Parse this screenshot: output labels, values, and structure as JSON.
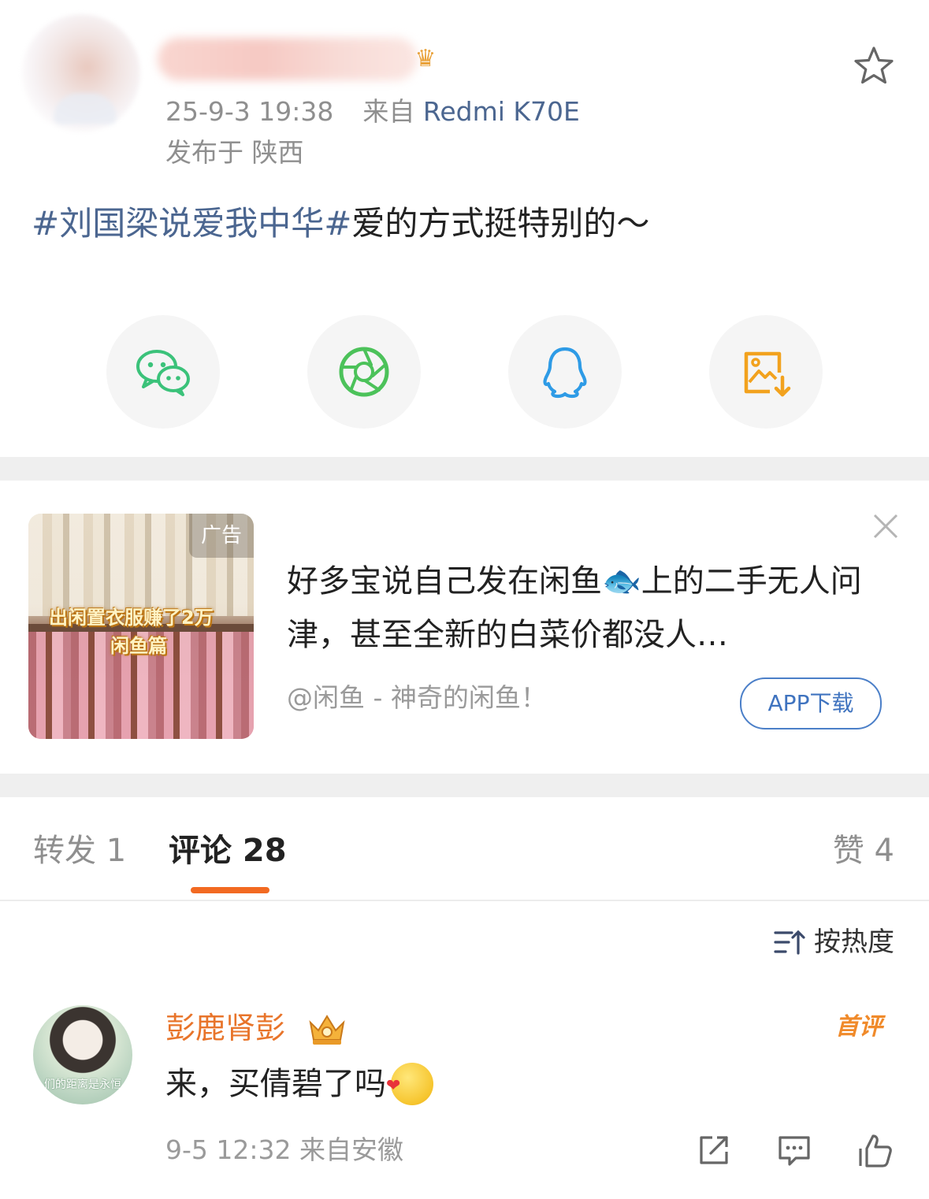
{
  "post": {
    "time": "25-9-3 19:38",
    "source_prefix": "来自",
    "source_device": "Redmi K70E",
    "location": "发布于 陕西",
    "topic": "#刘国梁说爱我中华#",
    "text": "爱的方式挺特别的～",
    "icons": {
      "favorite": "star-outline-icon",
      "vip": "crown-icon"
    }
  },
  "share": {
    "items": [
      {
        "name": "wechat",
        "icon": "wechat-icon",
        "color": "#3bc27a"
      },
      {
        "name": "moments",
        "icon": "moments-icon",
        "color": "#4cc25a"
      },
      {
        "name": "qq",
        "icon": "qq-icon",
        "color": "#2e9be6"
      },
      {
        "name": "save-image",
        "icon": "save-image-icon",
        "color": "#f2a21e"
      }
    ]
  },
  "ad": {
    "badge": "广告",
    "thumb_line1": "出闲置衣服赚了2万",
    "thumb_line2": "闲鱼篇",
    "title": "好多宝说自己发在闲鱼🐟上的二手无人问津，甚至全新的白菜价都没人…",
    "source": "@闲鱼 - 神奇的闲鱼！",
    "cta": "APP下载"
  },
  "tabs": {
    "repost": "转发 1",
    "comment": "评论 28",
    "like": "赞 4",
    "accent": "#f26a22"
  },
  "sort": {
    "label": "按热度"
  },
  "comments": [
    {
      "author": "彭鹿肾彭",
      "badge": "首评",
      "text": "来，买倩碧了吗",
      "meta": "9-5 12:32 来自安徽",
      "avatar_caption": "们的距离是永恒"
    }
  ]
}
